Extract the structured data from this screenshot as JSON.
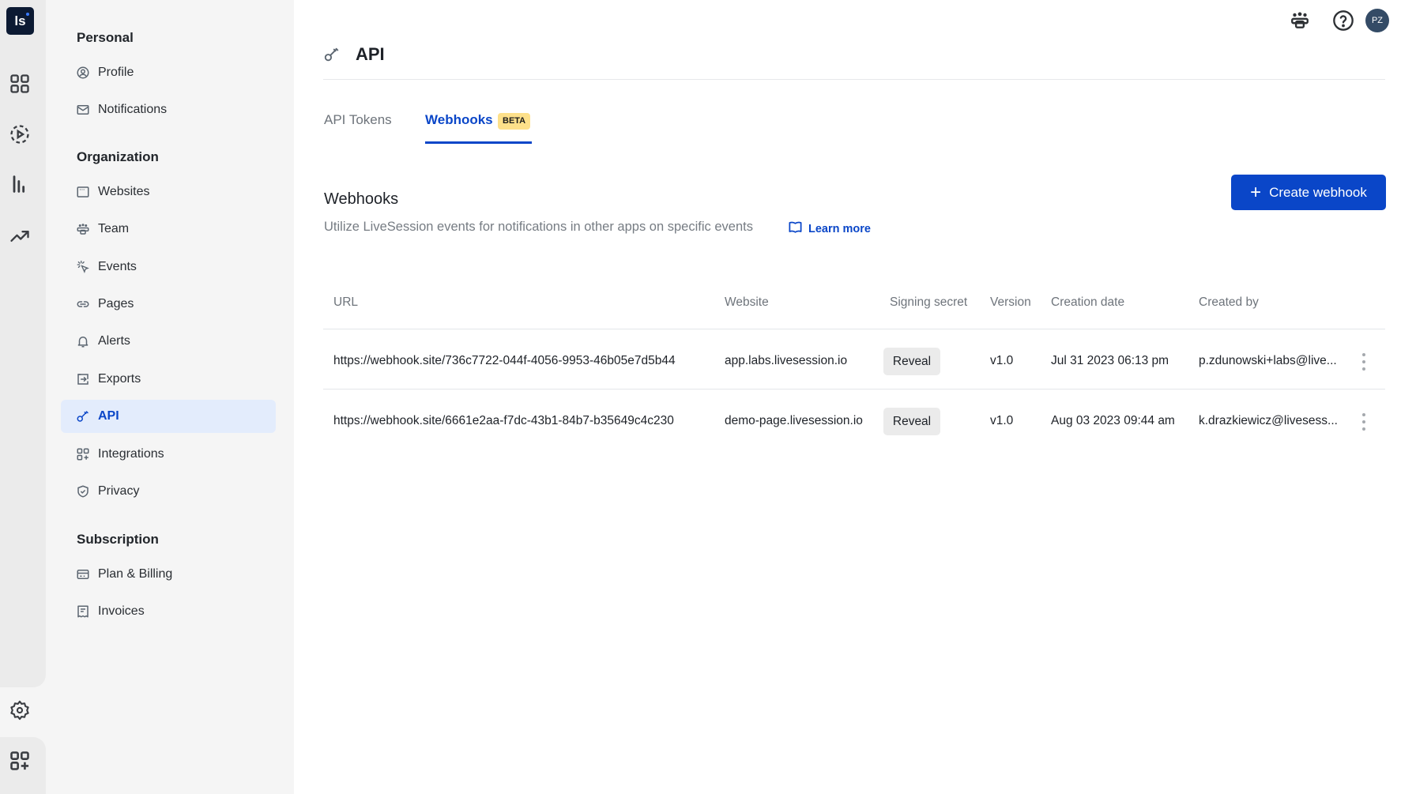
{
  "rail": {
    "logo_text": "ls",
    "icons": [
      "dashboard-icon",
      "recordings-icon",
      "analytics-icon",
      "trends-icon"
    ],
    "bottom_icons": [
      "settings-icon",
      "integrations-icon"
    ]
  },
  "sidebar": {
    "sections": [
      {
        "title": "Personal",
        "items": [
          {
            "label": "Profile",
            "icon": "profile-icon"
          },
          {
            "label": "Notifications",
            "icon": "mail-icon"
          }
        ]
      },
      {
        "title": "Organization",
        "items": [
          {
            "label": "Websites",
            "icon": "browser-icon"
          },
          {
            "label": "Team",
            "icon": "team-icon"
          },
          {
            "label": "Events",
            "icon": "click-icon"
          },
          {
            "label": "Pages",
            "icon": "link-icon"
          },
          {
            "label": "Alerts",
            "icon": "bell-icon"
          },
          {
            "label": "Exports",
            "icon": "export-icon"
          },
          {
            "label": "API",
            "icon": "key-icon",
            "active": true
          },
          {
            "label": "Integrations",
            "icon": "integrations-icon"
          },
          {
            "label": "Privacy",
            "icon": "shield-icon"
          }
        ]
      },
      {
        "title": "Subscription",
        "items": [
          {
            "label": "Plan & Billing",
            "icon": "credit-card-icon"
          },
          {
            "label": "Invoices",
            "icon": "receipt-icon"
          }
        ]
      }
    ]
  },
  "topbar": {
    "avatar_initials": "PZ"
  },
  "page": {
    "title": "API",
    "tabs": [
      {
        "label": "API Tokens",
        "active": false
      },
      {
        "label": "Webhooks",
        "active": true,
        "badge": "BETA"
      }
    ],
    "section_title": "Webhooks",
    "section_subtitle": "Utilize LiveSession events for notifications in other apps on specific events",
    "learn_more": "Learn more",
    "create_button": "Create webhook"
  },
  "table": {
    "columns": [
      "URL",
      "Website",
      "Signing secret",
      "Version",
      "Creation date",
      "Created by"
    ],
    "rows": [
      {
        "url": "https://webhook.site/736c7722-044f-4056-9953-46b05e7d5b44",
        "website": "app.labs.livesession.io",
        "secret_action": "Reveal",
        "version": "v1.0",
        "created": "Jul 31 2023 06:13 pm",
        "created_by": "p.zdunowski+labs@live..."
      },
      {
        "url": "https://webhook.site/6661e2aa-f7dc-43b1-84b7-b35649c4c230",
        "website": "demo-page.livesession.io",
        "secret_action": "Reveal",
        "version": "v1.0",
        "created": "Aug 03 2023 09:44 am",
        "created_by": "k.drazkiewicz@livesess..."
      }
    ]
  },
  "colors": {
    "accent": "#0a46c8",
    "active_bg": "#e3ecfc",
    "badge": "#fde08a",
    "logo_bg": "#0c1a33"
  }
}
